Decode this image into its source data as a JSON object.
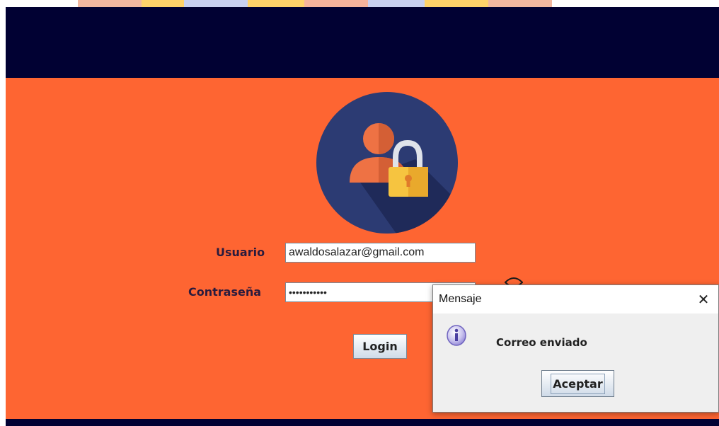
{
  "colors": {
    "header": "#010133",
    "main_background": "#fe6532",
    "label_text": "#2a1b3d",
    "avatar_circle": "#2c3b73",
    "avatar_person": "#ee7244",
    "lock_body": "#f6c440"
  },
  "login": {
    "user_label": "Usuario",
    "user_value": "awaldosalazar@gmail.com",
    "password_label": "Contraseña",
    "password_value": "12345678901",
    "login_button": "Login",
    "avatar_icon": "user-lock-icon",
    "eye_icon": "eye-icon"
  },
  "dialog": {
    "title": "Mensaje",
    "close_glyph": "✕",
    "message": "Correo enviado",
    "icon": "info-icon",
    "accept_button": "Aceptar"
  }
}
